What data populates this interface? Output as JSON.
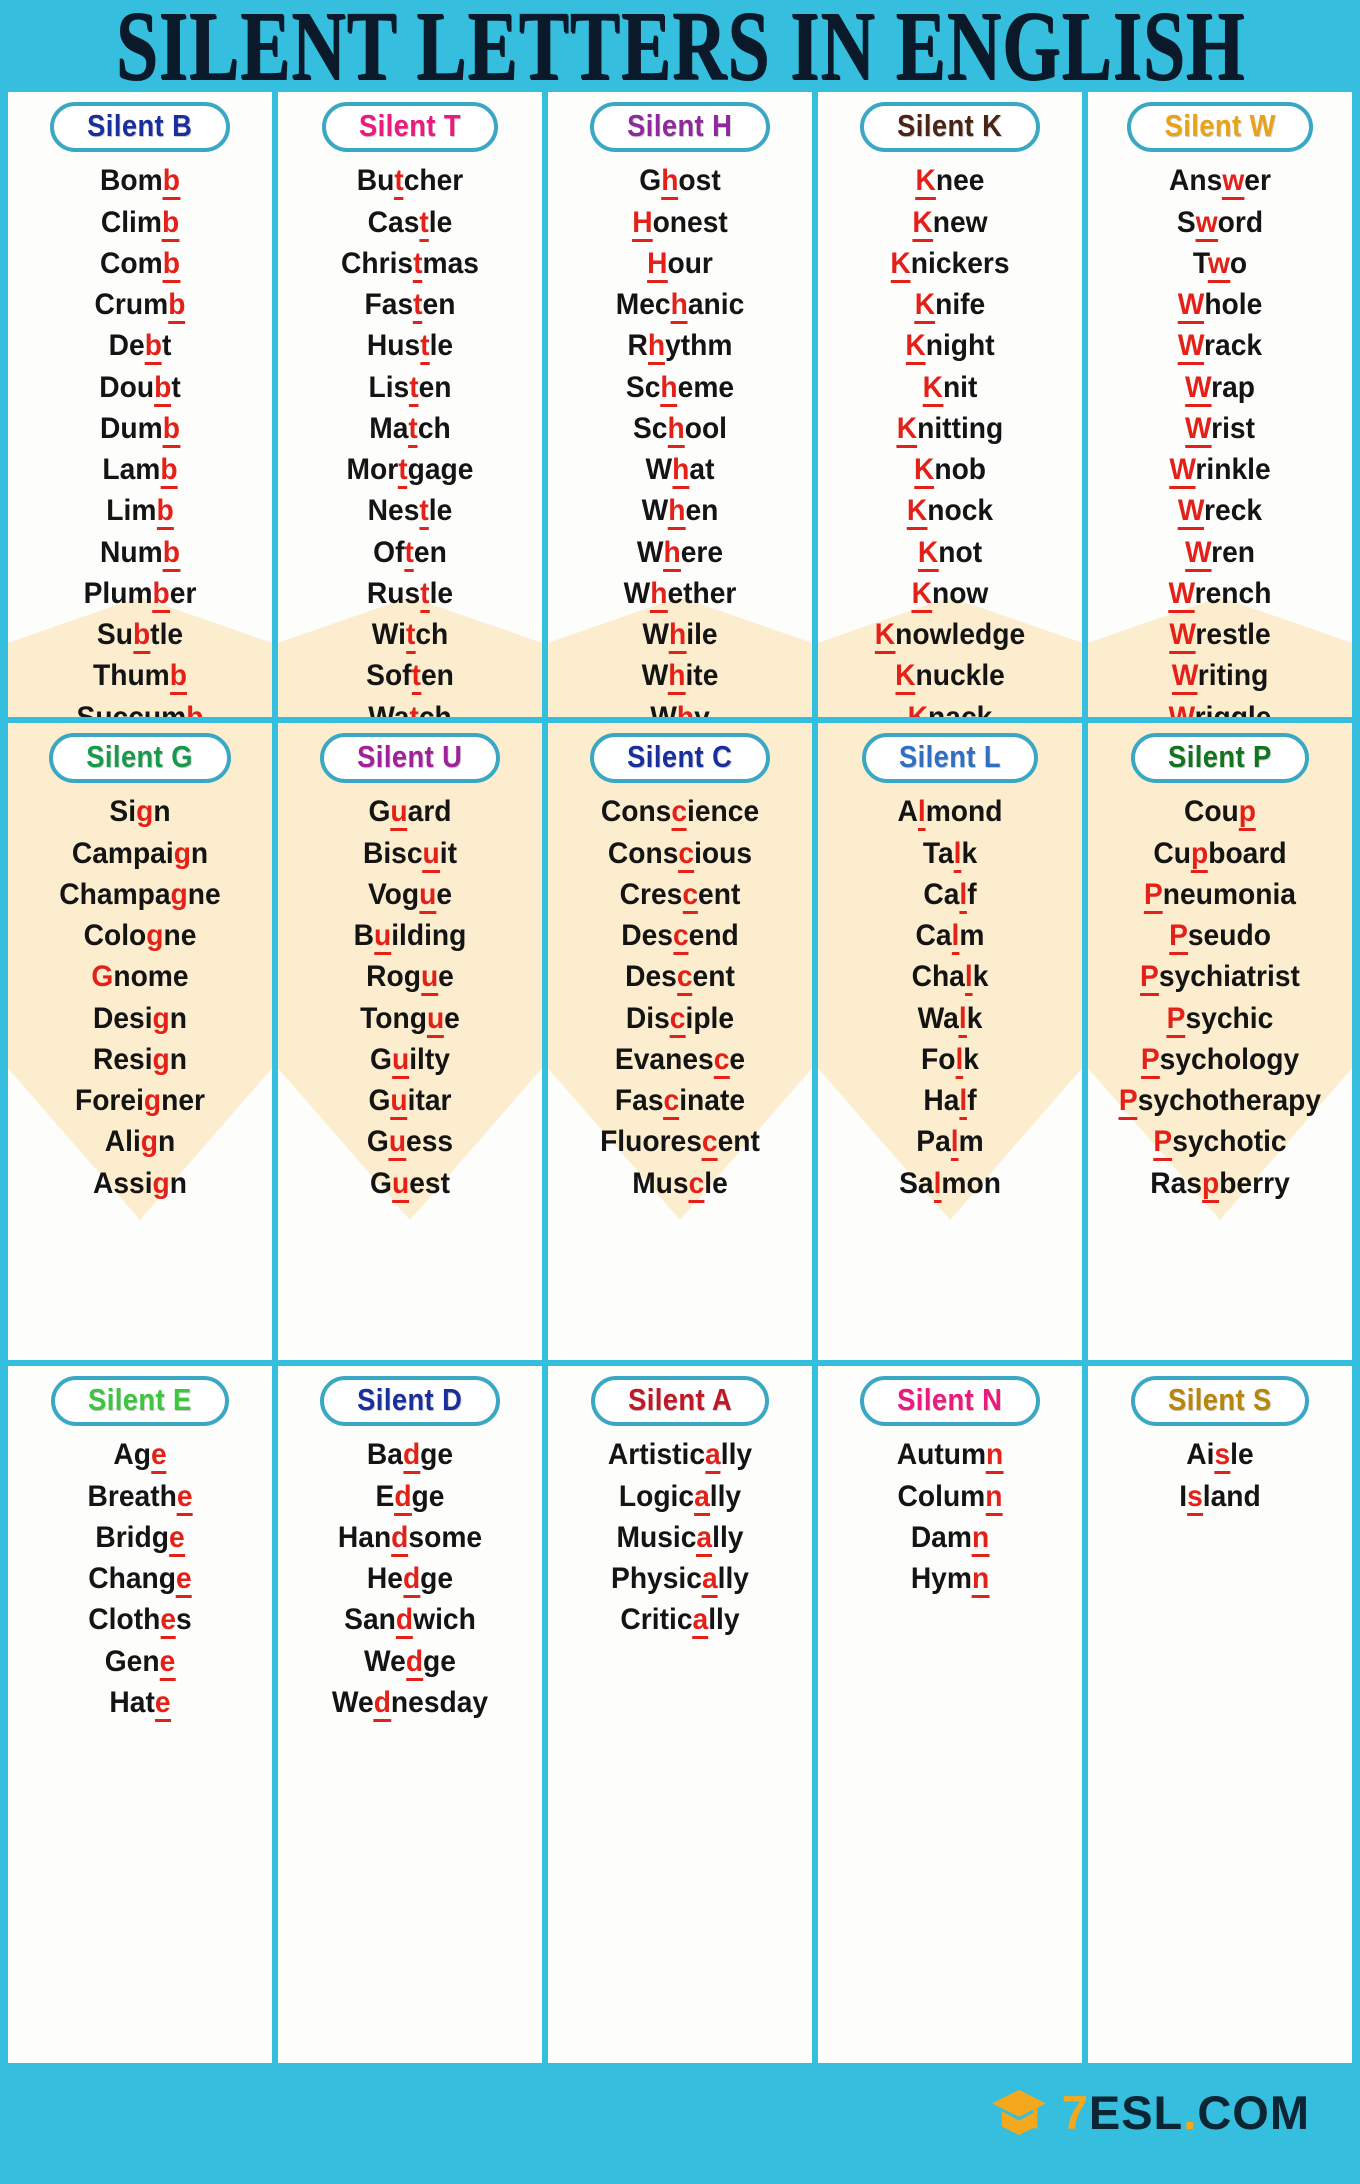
{
  "poster": {
    "title": "SILENT LETTERS IN ENGLISH",
    "background_color": "#35bedd",
    "card_background": "#fdfdfb",
    "pill_border_color": "#3aa8c4",
    "silent_letter_color": "#e32119",
    "word_color": "#141414",
    "watermark_color": "#fbeccb"
  },
  "footer": {
    "brand_seven": "7",
    "brand_esl": "ESL",
    "brand_dot": ".",
    "brand_com": "COM",
    "logo_icon": "graduation-cap-icon",
    "logo_accent_color": "#f4a81d",
    "logo_text_color": "#0c2535"
  },
  "sections": [
    {
      "id": "silent-b",
      "header": "Silent B",
      "header_color": "#1a2f9e",
      "words": [
        {
          "pre": "Bom",
          "silent": "b",
          "post": ""
        },
        {
          "pre": "Clim",
          "silent": "b",
          "post": ""
        },
        {
          "pre": "Com",
          "silent": "b",
          "post": ""
        },
        {
          "pre": "Crum",
          "silent": "b",
          "post": ""
        },
        {
          "pre": "De",
          "silent": "b",
          "post": "t"
        },
        {
          "pre": "Dou",
          "silent": "b",
          "post": "t"
        },
        {
          "pre": "Dum",
          "silent": "b",
          "post": ""
        },
        {
          "pre": "Lam",
          "silent": "b",
          "post": ""
        },
        {
          "pre": "Lim",
          "silent": "b",
          "post": ""
        },
        {
          "pre": "Num",
          "silent": "b",
          "post": ""
        },
        {
          "pre": "Plum",
          "silent": "b",
          "post": "er"
        },
        {
          "pre": "Su",
          "silent": "b",
          "post": "tle"
        },
        {
          "pre": "Thum",
          "silent": "b",
          "post": ""
        },
        {
          "pre": "Succum",
          "silent": "b",
          "post": ""
        }
      ]
    },
    {
      "id": "silent-t",
      "header": "Silent T",
      "header_color": "#eb1a7c",
      "words": [
        {
          "pre": "Bu",
          "silent": "t",
          "post": "cher"
        },
        {
          "pre": "Cas",
          "silent": "t",
          "post": "le"
        },
        {
          "pre": "Chris",
          "silent": "t",
          "post": "mas"
        },
        {
          "pre": "Fas",
          "silent": "t",
          "post": "en"
        },
        {
          "pre": "Hus",
          "silent": "t",
          "post": "le"
        },
        {
          "pre": "Lis",
          "silent": "t",
          "post": "en"
        },
        {
          "pre": "Ma",
          "silent": "t",
          "post": "ch"
        },
        {
          "pre": "Mor",
          "silent": "t",
          "post": "gage"
        },
        {
          "pre": "Nes",
          "silent": "t",
          "post": "le"
        },
        {
          "pre": "Of",
          "silent": "t",
          "post": "en"
        },
        {
          "pre": "Rus",
          "silent": "t",
          "post": "le"
        },
        {
          "pre": "Wi",
          "silent": "t",
          "post": "ch"
        },
        {
          "pre": "Sof",
          "silent": "t",
          "post": "en"
        },
        {
          "pre": "Wa",
          "silent": "t",
          "post": "ch"
        }
      ]
    },
    {
      "id": "silent-h",
      "header": "Silent H",
      "header_color": "#8e2a9b",
      "words": [
        {
          "pre": "G",
          "silent": "h",
          "post": "ost"
        },
        {
          "pre": "",
          "silent": "H",
          "post": "onest"
        },
        {
          "pre": "",
          "silent": "H",
          "post": "our"
        },
        {
          "pre": "Mec",
          "silent": "h",
          "post": "anic"
        },
        {
          "pre": "R",
          "silent": "h",
          "post": "ythm"
        },
        {
          "pre": "Sc",
          "silent": "h",
          "post": "eme"
        },
        {
          "pre": "Sc",
          "silent": "h",
          "post": "ool"
        },
        {
          "pre": "W",
          "silent": "h",
          "post": "at"
        },
        {
          "pre": "W",
          "silent": "h",
          "post": "en"
        },
        {
          "pre": "W",
          "silent": "h",
          "post": "ere"
        },
        {
          "pre": "W",
          "silent": "h",
          "post": "ether"
        },
        {
          "pre": "W",
          "silent": "h",
          "post": "ile"
        },
        {
          "pre": "W",
          "silent": "h",
          "post": "ite"
        },
        {
          "pre": "W",
          "silent": "h",
          "post": "y"
        }
      ]
    },
    {
      "id": "silent-k",
      "header": "Silent K",
      "header_color": "#4a2415",
      "words": [
        {
          "pre": "",
          "silent": "K",
          "post": "nee"
        },
        {
          "pre": "",
          "silent": "K",
          "post": "new"
        },
        {
          "pre": "",
          "silent": "K",
          "post": "nickers"
        },
        {
          "pre": "",
          "silent": "K",
          "post": "nife"
        },
        {
          "pre": "",
          "silent": "K",
          "post": "night"
        },
        {
          "pre": "",
          "silent": "K",
          "post": "nit"
        },
        {
          "pre": "",
          "silent": "K",
          "post": "nitting"
        },
        {
          "pre": "",
          "silent": "K",
          "post": "nob"
        },
        {
          "pre": "",
          "silent": "K",
          "post": "nock"
        },
        {
          "pre": "",
          "silent": "K",
          "post": "not"
        },
        {
          "pre": "",
          "silent": "K",
          "post": "now"
        },
        {
          "pre": "",
          "silent": "K",
          "post": "nowledge"
        },
        {
          "pre": "",
          "silent": "K",
          "post": "nuckle"
        },
        {
          "pre": "",
          "silent": "K",
          "post": "nack"
        }
      ]
    },
    {
      "id": "silent-w",
      "header": "Silent W",
      "header_color": "#e8a317",
      "words": [
        {
          "pre": "Ans",
          "silent": "w",
          "post": "er"
        },
        {
          "pre": "S",
          "silent": "w",
          "post": "ord"
        },
        {
          "pre": "T",
          "silent": "w",
          "post": "o"
        },
        {
          "pre": "",
          "silent": "W",
          "post": "hole"
        },
        {
          "pre": "",
          "silent": "W",
          "post": "rack"
        },
        {
          "pre": "",
          "silent": "W",
          "post": "rap"
        },
        {
          "pre": "",
          "silent": "W",
          "post": "rist"
        },
        {
          "pre": "",
          "silent": "W",
          "post": "rinkle"
        },
        {
          "pre": "",
          "silent": "W",
          "post": "reck"
        },
        {
          "pre": "",
          "silent": "W",
          "post": "ren"
        },
        {
          "pre": "",
          "silent": "W",
          "post": "rench"
        },
        {
          "pre": "",
          "silent": "W",
          "post": "restle"
        },
        {
          "pre": "",
          "silent": "W",
          "post": "riting"
        },
        {
          "pre": "",
          "silent": "W",
          "post": "riggle"
        }
      ]
    },
    {
      "id": "silent-g",
      "header": "Silent G",
      "header_color": "#179b4b",
      "words": [
        {
          "pre": "Si",
          "silent": "g",
          "post": "n",
          "underline": false
        },
        {
          "pre": "Campai",
          "silent": "g",
          "post": "n",
          "underline": false
        },
        {
          "pre": "Champa",
          "silent": "g",
          "post": "ne",
          "underline": false
        },
        {
          "pre": "Colo",
          "silent": "g",
          "post": "ne",
          "underline": false
        },
        {
          "pre": "",
          "silent": "G",
          "post": "nome",
          "underline": false
        },
        {
          "pre": "Desi",
          "silent": "g",
          "post": "n",
          "underline": false
        },
        {
          "pre": "Resi",
          "silent": "g",
          "post": "n",
          "underline": false
        },
        {
          "pre": "Forei",
          "silent": "g",
          "post": "ner",
          "underline": false
        },
        {
          "pre": "Ali",
          "silent": "g",
          "post": "n",
          "underline": false
        },
        {
          "pre": "Assi",
          "silent": "g",
          "post": "n",
          "underline": false
        }
      ]
    },
    {
      "id": "silent-u",
      "header": "Silent U",
      "header_color": "#a0219b",
      "words": [
        {
          "pre": "G",
          "silent": "u",
          "post": "ard"
        },
        {
          "pre": "Bisc",
          "silent": "u",
          "post": "it"
        },
        {
          "pre": "Vog",
          "silent": "u",
          "post": "e"
        },
        {
          "pre": "B",
          "silent": "u",
          "post": "ilding"
        },
        {
          "pre": "Rog",
          "silent": "u",
          "post": "e"
        },
        {
          "pre": "Tong",
          "silent": "u",
          "post": "e"
        },
        {
          "pre": "G",
          "silent": "u",
          "post": "ilty"
        },
        {
          "pre": "G",
          "silent": "u",
          "post": "itar"
        },
        {
          "pre": "G",
          "silent": "u",
          "post": "ess"
        },
        {
          "pre": "G",
          "silent": "u",
          "post": "est"
        }
      ]
    },
    {
      "id": "silent-c",
      "header": "Silent C",
      "header_color": "#1a2f9e",
      "words": [
        {
          "pre": "Cons",
          "silent": "c",
          "post": "ience"
        },
        {
          "pre": "Cons",
          "silent": "c",
          "post": "ious"
        },
        {
          "pre": "Cres",
          "silent": "c",
          "post": "ent"
        },
        {
          "pre": "Des",
          "silent": "c",
          "post": "end"
        },
        {
          "pre": "Des",
          "silent": "c",
          "post": "ent"
        },
        {
          "pre": "Dis",
          "silent": "c",
          "post": "iple"
        },
        {
          "pre": "Evanes",
          "silent": "c",
          "post": "e"
        },
        {
          "pre": "Fas",
          "silent": "c",
          "post": "inate"
        },
        {
          "pre": "Fluores",
          "silent": "c",
          "post": "ent"
        },
        {
          "pre": "Mus",
          "silent": "c",
          "post": "le"
        }
      ]
    },
    {
      "id": "silent-l",
      "header": "Silent L",
      "header_color": "#2f6fc4",
      "words": [
        {
          "pre": "A",
          "silent": "l",
          "post": "mond"
        },
        {
          "pre": "Ta",
          "silent": "l",
          "post": "k"
        },
        {
          "pre": "Ca",
          "silent": "l",
          "post": "f"
        },
        {
          "pre": "Ca",
          "silent": "l",
          "post": "m"
        },
        {
          "pre": "Cha",
          "silent": "l",
          "post": "k"
        },
        {
          "pre": "Wa",
          "silent": "l",
          "post": "k"
        },
        {
          "pre": "Fo",
          "silent": "l",
          "post": "k"
        },
        {
          "pre": "Ha",
          "silent": "l",
          "post": "f"
        },
        {
          "pre": "Pa",
          "silent": "l",
          "post": "m"
        },
        {
          "pre": "Sa",
          "silent": "l",
          "post": "mon"
        }
      ]
    },
    {
      "id": "silent-p",
      "header": "Silent P",
      "header_color": "#12741f",
      "words": [
        {
          "pre": "Cou",
          "silent": "p",
          "post": ""
        },
        {
          "pre": "Cu",
          "silent": "p",
          "post": "board"
        },
        {
          "pre": "",
          "silent": "P",
          "post": "neumonia"
        },
        {
          "pre": "",
          "silent": "P",
          "post": "seudo"
        },
        {
          "pre": "",
          "silent": "P",
          "post": "sychiatrist"
        },
        {
          "pre": "",
          "silent": "P",
          "post": "sychic"
        },
        {
          "pre": "",
          "silent": "P",
          "post": "sychology"
        },
        {
          "pre": "",
          "silent": "P",
          "post": "sychotherapy"
        },
        {
          "pre": "",
          "silent": "P",
          "post": "sychotic"
        },
        {
          "pre": "Ras",
          "silent": "p",
          "post": "berry"
        }
      ]
    },
    {
      "id": "silent-e",
      "header": "Silent E",
      "header_color": "#3ec43e",
      "words": [
        {
          "pre": "Ag",
          "silent": "e",
          "post": ""
        },
        {
          "pre": "Breath",
          "silent": "e",
          "post": ""
        },
        {
          "pre": "Bridg",
          "silent": "e",
          "post": ""
        },
        {
          "pre": "Chang",
          "silent": "e",
          "post": ""
        },
        {
          "pre": "Cloth",
          "silent": "e",
          "post": "s"
        },
        {
          "pre": "Gen",
          "silent": "e",
          "post": ""
        },
        {
          "pre": "Hat",
          "silent": "e",
          "post": ""
        }
      ]
    },
    {
      "id": "silent-d",
      "header": "Silent D",
      "header_color": "#1a2f9e",
      "words": [
        {
          "pre": "Ba",
          "silent": "d",
          "post": "ge"
        },
        {
          "pre": "E",
          "silent": "d",
          "post": "ge"
        },
        {
          "pre": "Han",
          "silent": "d",
          "post": "some"
        },
        {
          "pre": "He",
          "silent": "d",
          "post": "ge"
        },
        {
          "pre": "San",
          "silent": "d",
          "post": "wich"
        },
        {
          "pre": "We",
          "silent": "d",
          "post": "ge"
        },
        {
          "pre": "We",
          "silent": "d",
          "post": "nesday"
        }
      ]
    },
    {
      "id": "silent-a",
      "header": "Silent A",
      "header_color": "#c01826",
      "words": [
        {
          "pre": "Artistic",
          "silent": "a",
          "post": "lly"
        },
        {
          "pre": "Logic",
          "silent": "a",
          "post": "lly"
        },
        {
          "pre": "Music",
          "silent": "a",
          "post": "lly"
        },
        {
          "pre": "Physic",
          "silent": "a",
          "post": "lly"
        },
        {
          "pre": "Critic",
          "silent": "a",
          "post": "lly"
        }
      ]
    },
    {
      "id": "silent-n",
      "header": "Silent N",
      "header_color": "#eb1a7c",
      "words": [
        {
          "pre": "Autum",
          "silent": "n",
          "post": ""
        },
        {
          "pre": "Colum",
          "silent": "n",
          "post": ""
        },
        {
          "pre": "Dam",
          "silent": "n",
          "post": ""
        },
        {
          "pre": "Hym",
          "silent": "n",
          "post": ""
        }
      ]
    },
    {
      "id": "silent-s",
      "header": "Silent S",
      "header_color": "#b8860b",
      "words": [
        {
          "pre": "Ai",
          "silent": "s",
          "post": "le"
        },
        {
          "pre": "I",
          "silent": "s",
          "post": "land"
        }
      ]
    }
  ]
}
